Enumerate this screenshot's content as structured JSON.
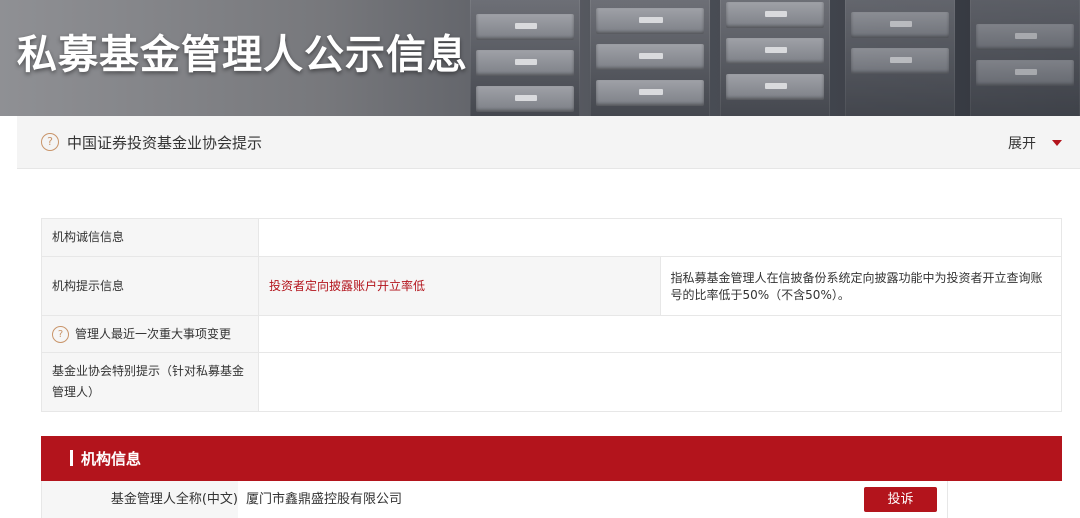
{
  "banner": {
    "title": "私募基金管理人公示信息"
  },
  "notice": {
    "text": "中国证券投资基金业协会提示",
    "expand_label": "展开",
    "icon": "question-circle-icon"
  },
  "info": {
    "rows": [
      {
        "label": "机构诚信信息"
      },
      {
        "label": "机构提示信息",
        "tag": "投资者定向披露账户开立率低",
        "description": "指私募基金管理人在信披备份系统定向披露功能中为投资者开立查询账号的比率低于50%（不含50%）。"
      },
      {
        "label": "管理人最近一次重大事项变更",
        "icon": "question-circle-icon"
      },
      {
        "label": "基金业协会特别提示（针对私募基金管理人）"
      }
    ]
  },
  "section": {
    "title": "机构信息"
  },
  "org": {
    "name_label": "基金管理人全称(中文)",
    "name_value": "厦门市鑫鼎盛控股有限公司",
    "complaint_button": "投诉"
  },
  "colors": {
    "accent": "#b3141c",
    "icon": "#c9956a"
  }
}
